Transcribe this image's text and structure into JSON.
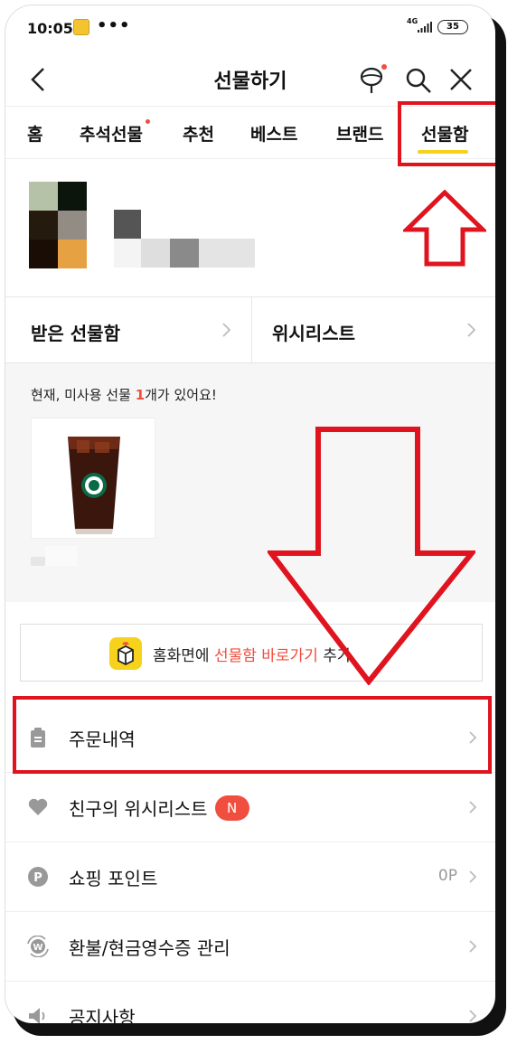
{
  "status_bar": {
    "time": "10:05",
    "more": "•••",
    "network": "4G",
    "battery": "35"
  },
  "header": {
    "title": "선물하기"
  },
  "tabs": [
    {
      "label": "홈"
    },
    {
      "label": "추석선물",
      "has_dot": true
    },
    {
      "label": "추천"
    },
    {
      "label": "베스트"
    },
    {
      "label": "브랜드"
    },
    {
      "label": "선물함",
      "active": true
    }
  ],
  "boxes": {
    "received": "받은 선물함",
    "wishlist": "위시리스트"
  },
  "unused": {
    "prefix": "현재, 미사용 선물 ",
    "count": "1",
    "suffix": "개가 있어요!"
  },
  "shortcut": {
    "prefix": "홈화면에 ",
    "highlight": "선물함 바로가기",
    "suffix": " 추가"
  },
  "menu": [
    {
      "label": "주문내역",
      "icon": "clipboard-icon"
    },
    {
      "label": "친구의 위시리스트",
      "icon": "heart-icon",
      "badge": "N"
    },
    {
      "label": "쇼핑 포인트",
      "icon": "point-icon",
      "value": "0P"
    },
    {
      "label": "환불/현금영수증 관리",
      "icon": "refund-icon"
    },
    {
      "label": "공지사항",
      "icon": "speaker-icon"
    }
  ],
  "colors": {
    "accent": "#f7d21c",
    "red": "#f04e3e",
    "annotation": "#e0141e"
  }
}
